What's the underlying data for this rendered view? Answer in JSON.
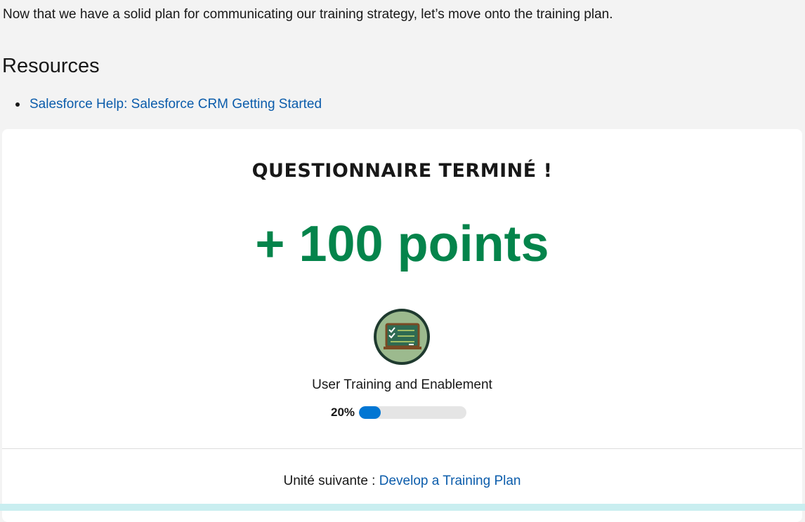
{
  "intro": {
    "text": "Now that we have a solid plan for communicating our training strategy, let’s move onto the training plan."
  },
  "resources": {
    "heading": "Resources",
    "links": [
      {
        "label": "Salesforce Help: Salesforce CRM Getting Started"
      }
    ]
  },
  "completion": {
    "title": "QUESTIONNAIRE TERMINÉ !",
    "points": "+ 100 points",
    "badge": {
      "icon": "chalkboard-checklist-icon",
      "name": "User Training and Enablement"
    },
    "progress": {
      "label": "20%",
      "value": 0.2
    },
    "next_unit": {
      "prefix": "Unité suivante : ",
      "link_label": "Develop a Training Plan"
    }
  },
  "colors": {
    "link": "#0b5cab",
    "points_green": "#04844b",
    "progress_blue": "#0176d3",
    "badge_green": "#9cba8e",
    "badge_ring": "#1f3a2f"
  }
}
